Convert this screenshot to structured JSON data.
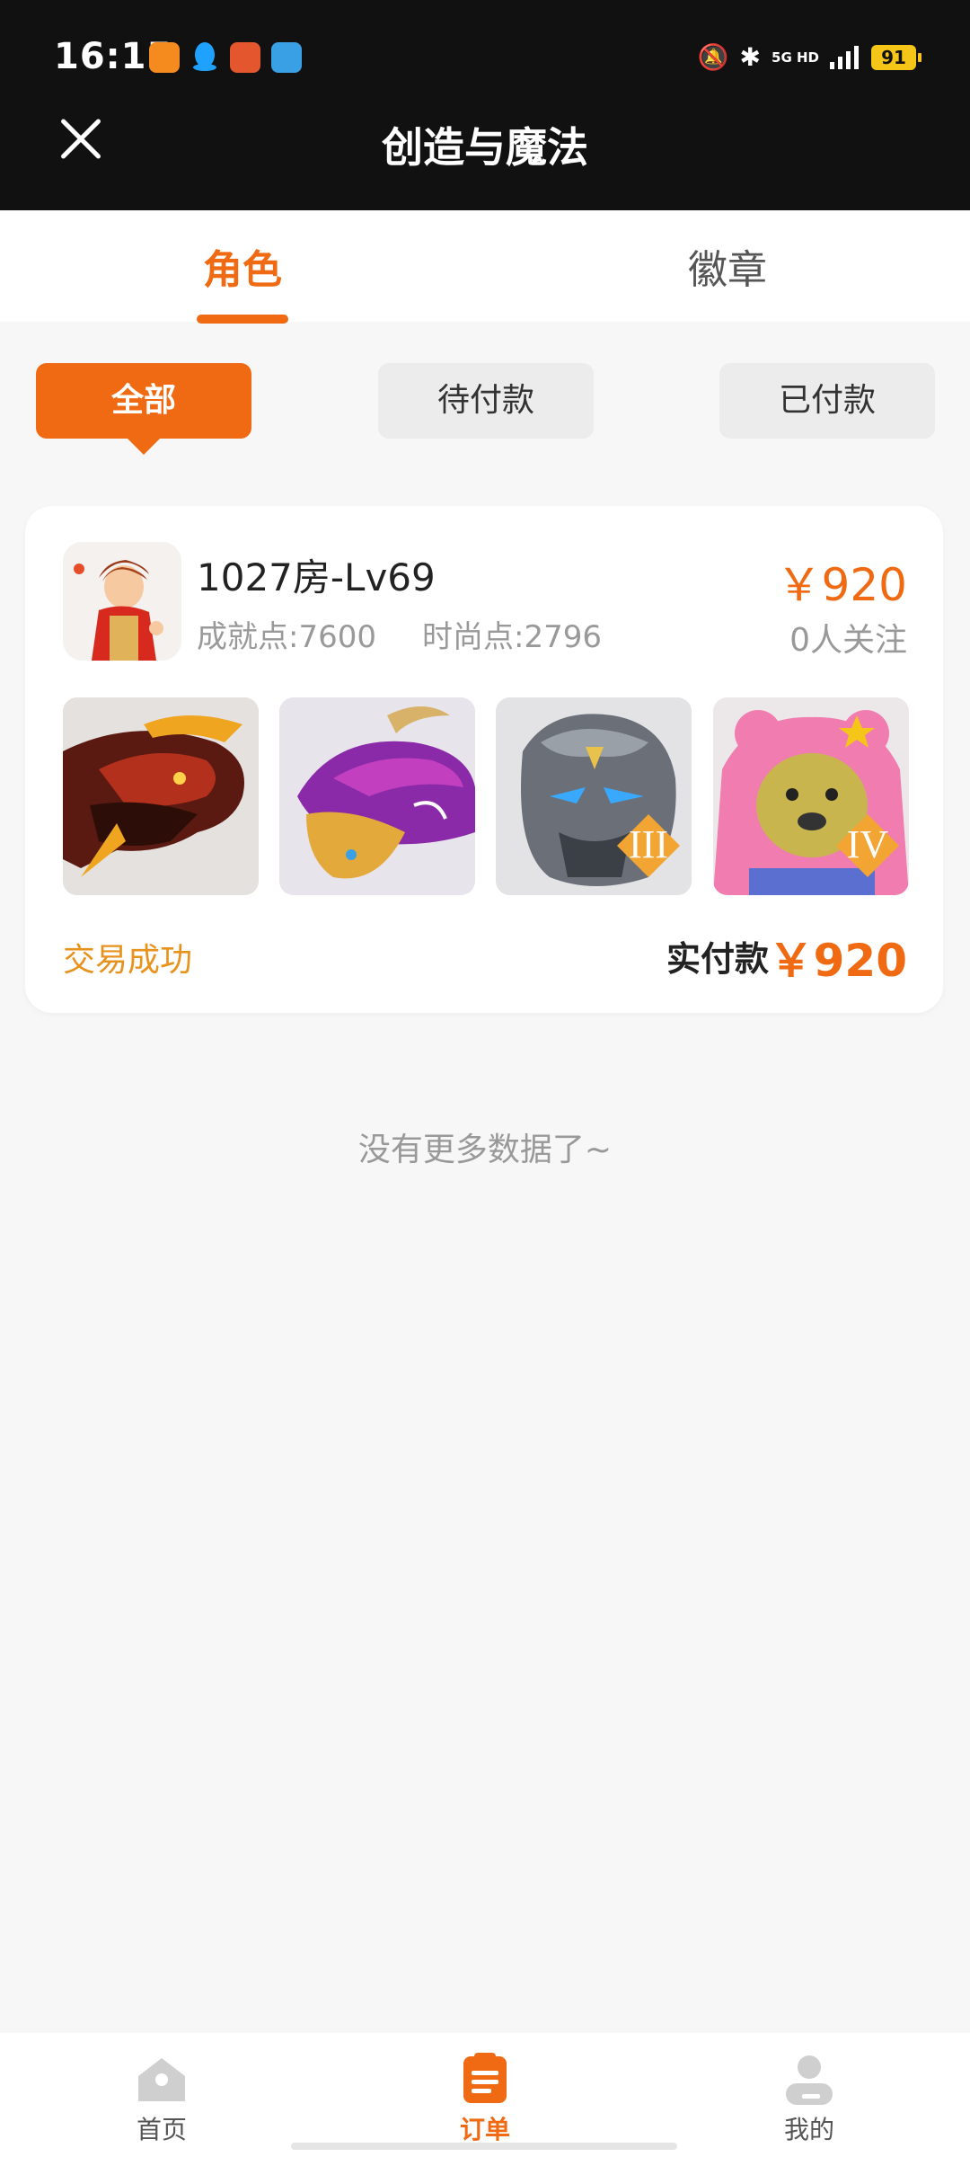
{
  "status_bar": {
    "time": "16:15",
    "network": "5G HD",
    "battery": "91"
  },
  "header": {
    "title": "创造与魔法"
  },
  "tabs": [
    {
      "label": "角色",
      "active": true
    },
    {
      "label": "徽章",
      "active": false
    }
  ],
  "filters": [
    {
      "label": "全部",
      "active": true
    },
    {
      "label": "待付款",
      "active": false
    },
    {
      "label": "已付款",
      "active": false
    }
  ],
  "order": {
    "room": "1027房-Lv69",
    "achievement": "成就点:7600",
    "fashion": "时尚点:2796",
    "price": "￥920",
    "followers": "0人关注",
    "status": "交易成功",
    "paid_label": "实付款",
    "paid_amount": "￥920",
    "thumbnails": [
      {
        "icon": "dragon-mount-icon"
      },
      {
        "icon": "whale-mount-icon"
      },
      {
        "icon": "rock-golem-icon",
        "badge": "III"
      },
      {
        "icon": "pink-bear-icon",
        "badge": "IV"
      }
    ]
  },
  "footer_note": "没有更多数据了~",
  "bottom_nav": [
    {
      "label": "首页",
      "icon": "home-icon",
      "active": false
    },
    {
      "label": "订单",
      "icon": "orders-icon",
      "active": true
    },
    {
      "label": "我的",
      "icon": "profile-icon",
      "active": false
    }
  ],
  "colors": {
    "accent": "#ef6a12",
    "status_success": "#e8921e",
    "background": "#f7f7f7"
  }
}
